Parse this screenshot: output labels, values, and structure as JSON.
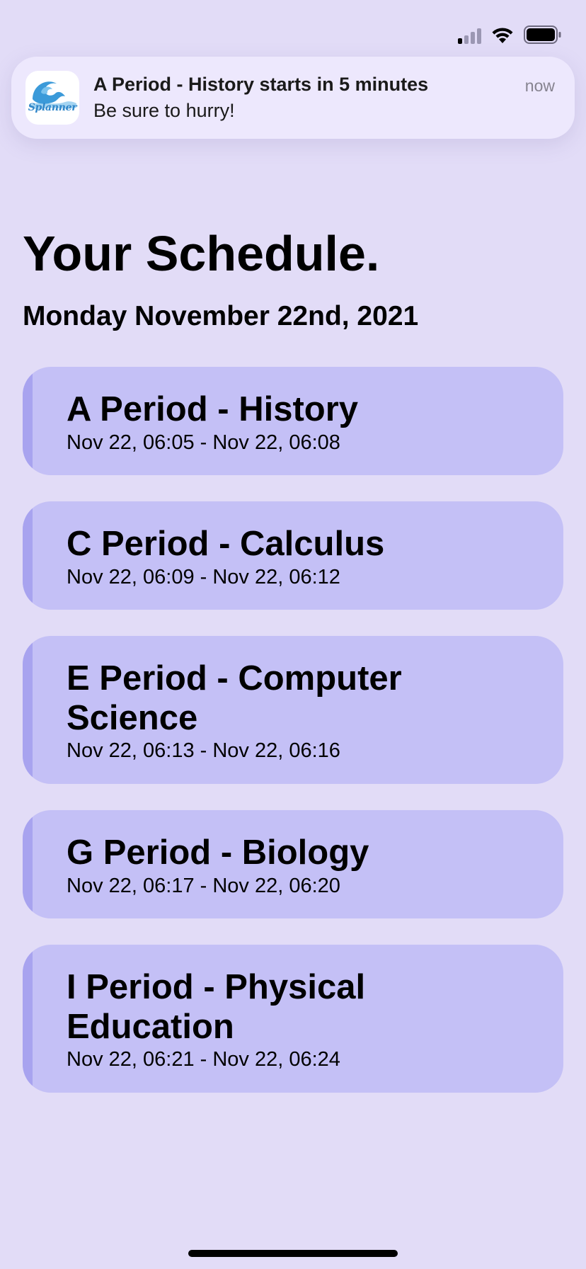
{
  "status_bar": {
    "signal_icon": "cellular-signal-icon",
    "wifi_icon": "wifi-icon",
    "battery_icon": "battery-icon"
  },
  "notification": {
    "app_name": "Splanner",
    "app_icon": "splanner-wave-logo-icon",
    "title": "A Period - History starts in 5 minutes",
    "body": "Be sure to hurry!",
    "time": "now"
  },
  "header": {
    "title": "Your Schedule.",
    "date": "Monday November 22nd, 2021"
  },
  "schedule": [
    {
      "title": "A Period - History",
      "time": "Nov 22, 06:05 - Nov 22, 06:08"
    },
    {
      "title": "C Period - Calculus",
      "time": "Nov 22, 06:09 - Nov 22, 06:12"
    },
    {
      "title": "E Period - Computer Science",
      "time": "Nov 22, 06:13 - Nov 22, 06:16"
    },
    {
      "title": "G Period - Biology",
      "time": "Nov 22, 06:17 - Nov 22, 06:20"
    },
    {
      "title": "I Period - Physical Education",
      "time": "Nov 22, 06:21 - Nov 22, 06:24"
    }
  ],
  "colors": {
    "background": "#e2dcf7",
    "card": "#c4c0f6",
    "card_accent": "#a8a3ef",
    "notification": "#ede8fd",
    "logo_blue": "#2f86c9"
  }
}
